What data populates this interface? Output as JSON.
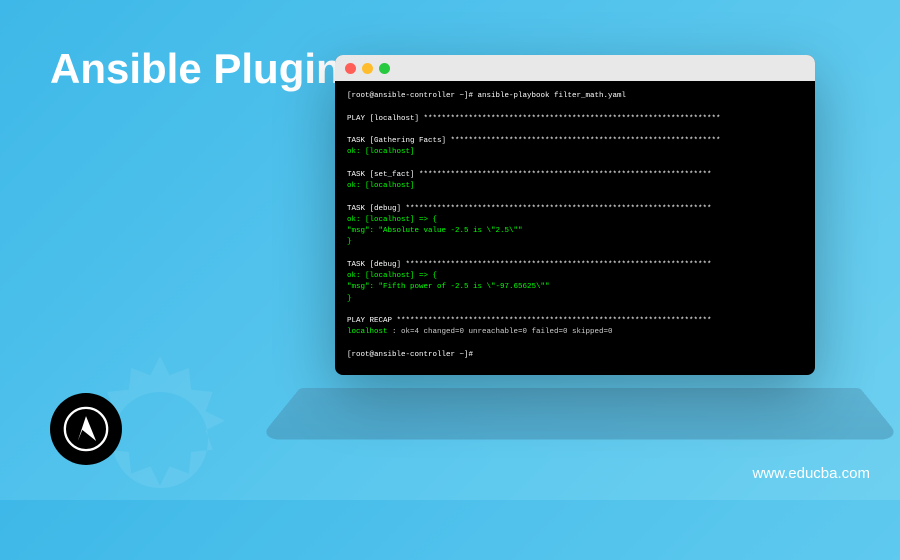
{
  "title": "Ansible Plugins",
  "website": "www.educba.com",
  "terminal": {
    "prompt1": "[root@ansible-controller ~]# ansible-playbook filter_math.yaml",
    "play_header": "PLAY [localhost] ******************************************************************",
    "task_gather": "TASK [Gathering Facts] ************************************************************",
    "ok_localhost": "ok: [localhost]",
    "task_setfact": "TASK [set_fact] *****************************************************************",
    "task_debug": "TASK [debug] ********************************************************************",
    "debug1_line1": "ok: [localhost] => {",
    "debug1_msg": "    \"msg\": \"Absolute value -2.5 is \\\"2.5\\\"\"",
    "debug1_close": "}",
    "debug2_line1": "ok: [localhost] => {",
    "debug2_msg": "    \"msg\": \"Fifth power of -2.5 is \\\"-97.65625\\\"\"",
    "debug2_close": "}",
    "recap_header": "PLAY RECAP **********************************************************************",
    "recap_host": "localhost",
    "recap_stats": "           : ok=4    changed=0    unreachable=0    failed=0    skipped=0",
    "prompt2": "[root@ansible-controller ~]#"
  }
}
